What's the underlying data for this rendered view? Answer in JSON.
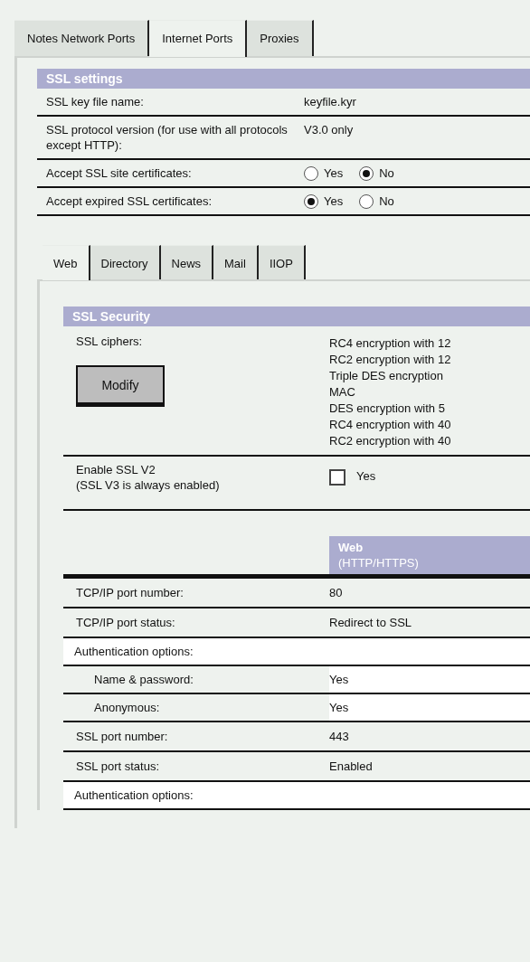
{
  "tabs": [
    {
      "label": "Notes Network Ports",
      "selected": false
    },
    {
      "label": "Internet Ports",
      "selected": true
    },
    {
      "label": "Proxies",
      "selected": false
    }
  ],
  "ssl_settings": {
    "title": "SSL settings",
    "rows": [
      {
        "kind": "text",
        "label": "SSL key file name:",
        "value": "keyfile.kyr"
      },
      {
        "kind": "text",
        "label": "SSL protocol version (for use with all protocols except HTTP):",
        "value": "V3.0 only"
      },
      {
        "kind": "radio",
        "label": "Accept SSL site certificates:",
        "options": [
          {
            "label": "Yes",
            "selected": false
          },
          {
            "label": "No",
            "selected": true
          }
        ]
      },
      {
        "kind": "radio",
        "label": "Accept expired SSL certificates:",
        "options": [
          {
            "label": "Yes",
            "selected": true
          },
          {
            "label": "No",
            "selected": false
          }
        ]
      }
    ]
  },
  "sub_tabs": [
    {
      "label": "Web",
      "selected": true
    },
    {
      "label": "Directory",
      "selected": false
    },
    {
      "label": "News",
      "selected": false
    },
    {
      "label": "Mail",
      "selected": false
    },
    {
      "label": "IIOP",
      "selected": false
    }
  ],
  "ssl_security": {
    "title": "SSL Security",
    "rows": [
      {
        "kind": "ciphers",
        "label": "SSL ciphers:",
        "button": "Modify",
        "values": [
          "RC4 encryption with 12",
          "RC2 encryption with 12",
          "Triple DES encryption",
          "MAC",
          "DES encryption with 5",
          "RC4 encryption with 40",
          "RC2 encryption with 40"
        ]
      },
      {
        "kind": "checkbox",
        "label": "Enable SSL V2",
        "note": "(SSL V3 is always enabled)",
        "option": "Yes",
        "checked": false
      }
    ]
  },
  "ports": {
    "column": {
      "title": "Web",
      "subtitle": "(HTTP/HTTPS)"
    },
    "rows": [
      {
        "kind": "value",
        "label": "TCP/IP port number:",
        "value": "80"
      },
      {
        "kind": "value",
        "label": "TCP/IP port status:",
        "value": "Redirect to SSL"
      },
      {
        "kind": "section",
        "label": "Authentication options:"
      },
      {
        "kind": "subvalue",
        "label": "Name & password:",
        "value": "Yes"
      },
      {
        "kind": "subvalue",
        "label": "Anonymous:",
        "value": "Yes"
      },
      {
        "kind": "value",
        "label": "SSL port number:",
        "value": "443"
      },
      {
        "kind": "value",
        "label": "SSL port status:",
        "value": "Enabled"
      },
      {
        "kind": "section",
        "label": "Authentication options:"
      }
    ]
  }
}
